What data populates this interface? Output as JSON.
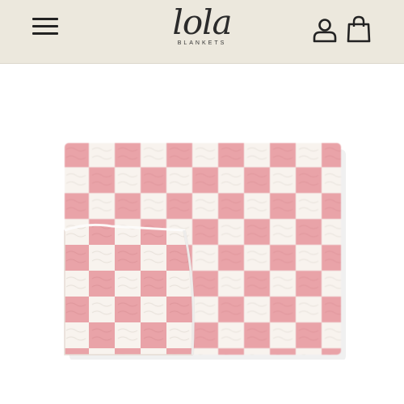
{
  "header": {
    "logo": {
      "wordmark": "lola",
      "subtitle": "BLANKETS"
    },
    "icons": {
      "menu": "hamburger-menu-icon",
      "account": "user-account-icon",
      "cart": "shopping-bag-icon"
    }
  },
  "product": {
    "image": "pink-and-white-checkered-blanket",
    "colors": {
      "pink": "#e9a3a8",
      "cream": "#f8f3ee"
    }
  },
  "colors": {
    "header_background": "#ece8dd",
    "icon": "#222222",
    "page_background": "#ffffff"
  }
}
